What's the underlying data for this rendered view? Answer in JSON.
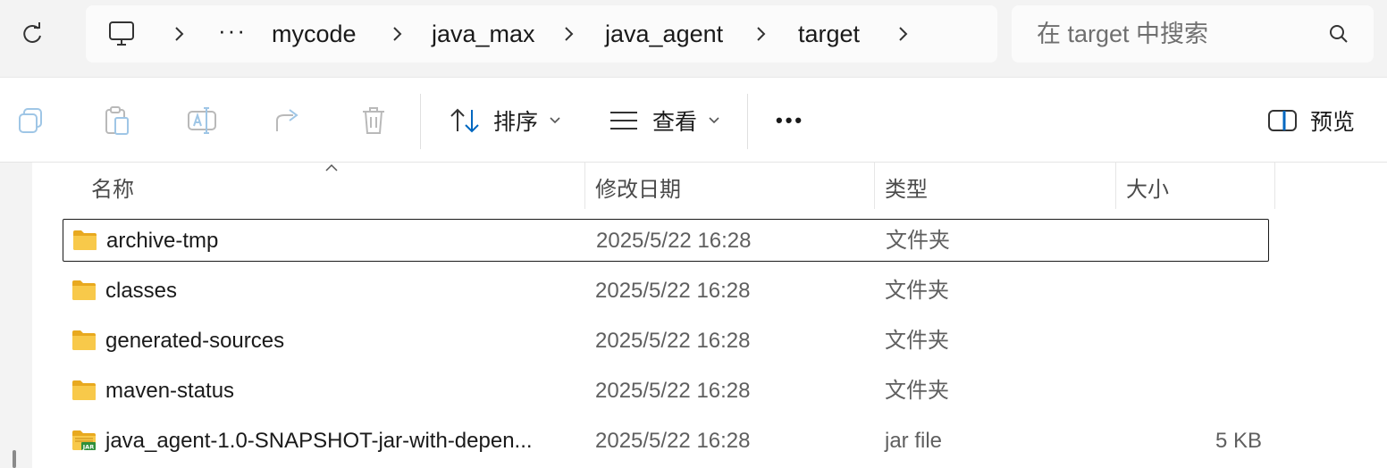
{
  "address_bar": {
    "breadcrumb": [
      "mycode",
      "java_max",
      "java_agent",
      "target"
    ],
    "overflow": "···"
  },
  "search": {
    "placeholder": "在 target 中搜索"
  },
  "toolbar": {
    "sort_label": "排序",
    "view_label": "查看",
    "more_label": "•••",
    "preview_label": "预览"
  },
  "columns": {
    "name": "名称",
    "modified": "修改日期",
    "type": "类型",
    "size": "大小"
  },
  "files": [
    {
      "name": "archive-tmp",
      "modified": "2025/5/22 16:28",
      "type": "文件夹",
      "size": "",
      "kind": "folder",
      "selected": true
    },
    {
      "name": "classes",
      "modified": "2025/5/22 16:28",
      "type": "文件夹",
      "size": "",
      "kind": "folder"
    },
    {
      "name": "generated-sources",
      "modified": "2025/5/22 16:28",
      "type": "文件夹",
      "size": "",
      "kind": "folder"
    },
    {
      "name": "maven-status",
      "modified": "2025/5/22 16:28",
      "type": "文件夹",
      "size": "",
      "kind": "folder"
    },
    {
      "name": "java_agent-1.0-SNAPSHOT-jar-with-depen...",
      "modified": "2025/5/22 16:28",
      "type": "jar file",
      "size": "5 KB",
      "kind": "jar"
    }
  ],
  "jar_badge": "JAR",
  "colors": {
    "folder": "#f5c242",
    "accent": "#0067c0"
  }
}
